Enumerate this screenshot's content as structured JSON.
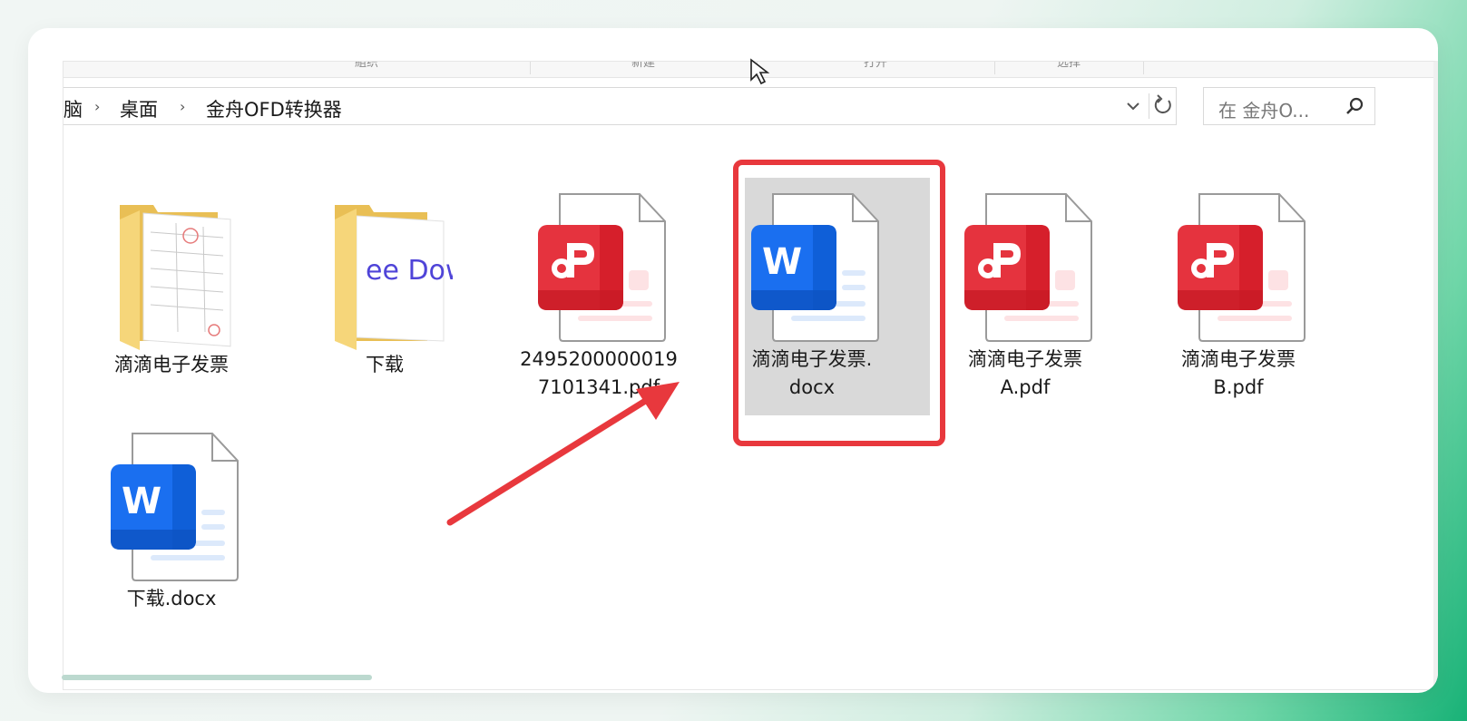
{
  "ribbon": {
    "groups": [
      "組织",
      "新建",
      "打开",
      "选择"
    ]
  },
  "address": {
    "crumbs": [
      "脑",
      "桌面",
      "金舟OFD转换器"
    ],
    "separator": "›"
  },
  "search": {
    "placeholder": "在 金舟O..."
  },
  "files": [
    {
      "name": "滴滴电子发票",
      "type": "folder"
    },
    {
      "name": "下载",
      "type": "folder",
      "preview_text": "ee Dow"
    },
    {
      "name": "24952000000197101341.pdf",
      "line1": "2495200000019",
      "line2": "7101341.pdf",
      "type": "pdf"
    },
    {
      "name": "滴滴电子发票.docx",
      "line1": "滴滴电子发票.",
      "line2": "docx",
      "type": "docx",
      "selected": true
    },
    {
      "name": "滴滴电子发票A.pdf",
      "line1": "滴滴电子发票",
      "line2": "A.pdf",
      "type": "pdf"
    },
    {
      "name": "滴滴电子发票B.pdf",
      "line1": "滴滴电子发票",
      "line2": "B.pdf",
      "type": "pdf"
    },
    {
      "name": "下载.docx",
      "type": "docx"
    }
  ],
  "colors": {
    "highlight": "#e8383d",
    "pdf_red": "#e5333e",
    "word_blue": "#1a6ff0",
    "folder_yellow": "#f6d67a"
  }
}
